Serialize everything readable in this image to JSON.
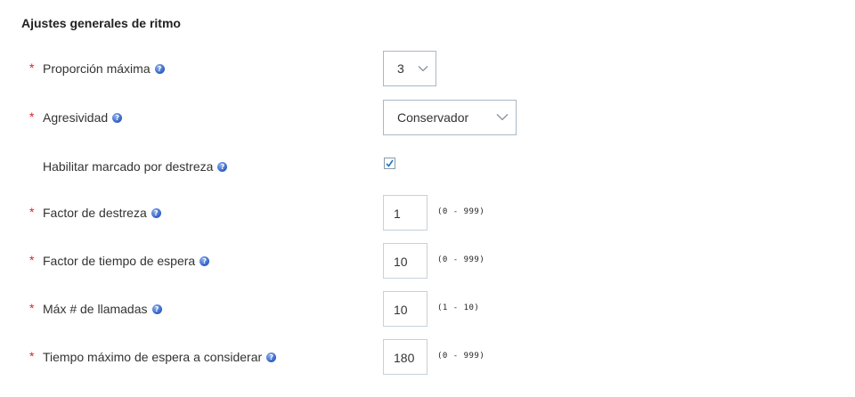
{
  "section": {
    "title": "Ajustes generales de ritmo"
  },
  "fields": {
    "max_ratio": {
      "required": "*",
      "label": "Proporción máxima",
      "value": "3"
    },
    "aggressiveness": {
      "required": "*",
      "label": "Agresividad",
      "value": "Conservador"
    },
    "skill_dialing": {
      "label": "Habilitar marcado por destreza",
      "checked": true
    },
    "skill_factor": {
      "required": "*",
      "label": "Factor de destreza",
      "value": "1",
      "range": "(0 - 999)"
    },
    "wait_time_factor": {
      "required": "*",
      "label": "Factor de tiempo de espera",
      "value": "10",
      "range": "(0 - 999)"
    },
    "max_calls": {
      "required": "*",
      "label": "Máx # de llamadas",
      "value": "10",
      "range": "(1 - 10)"
    },
    "max_wait_time": {
      "required": "*",
      "label": "Tiempo máximo de espera a considerar",
      "value": "180",
      "range": "(0 - 999)"
    }
  },
  "icons": {
    "help": "help-icon",
    "select_arrow": "chevron-down-icon",
    "check": "check-icon"
  },
  "colors": {
    "required": "#e02020",
    "help_icon": "#2f5fc4",
    "check": "#1a73c8"
  }
}
